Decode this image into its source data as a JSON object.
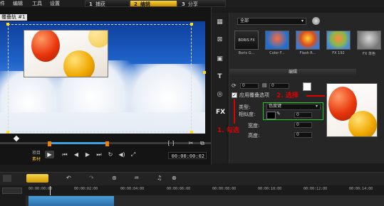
{
  "menu": [
    "件",
    "编辑",
    "工具",
    "设置"
  ],
  "steps": [
    {
      "num": "1",
      "label": "捕获"
    },
    {
      "num": "2",
      "label": "编辑"
    },
    {
      "num": "3",
      "label": "分享"
    }
  ],
  "preview": {
    "track_label": "覆叠轨 #1",
    "timecode": "00:00:00:02",
    "project_label": "项目",
    "clip_label": "素材"
  },
  "library": {
    "category": "全部",
    "thumbnails": [
      "Boris G...",
      "Color F...",
      "Flash R...",
      "FX 192",
      "FX 单色"
    ]
  },
  "options": {
    "tab_label": "编辑",
    "apply_overlay_label": "应用覆叠选项",
    "type_label": "类型:",
    "type_value": "色度键",
    "similarity_label": "相似度:",
    "width_label": "宽度:",
    "height_label": "高度:",
    "spin_value": "0"
  },
  "annotations": {
    "check": "1. 勾选",
    "choose": "2. 选择"
  },
  "timeline": {
    "ticks": [
      "00:00:00:00",
      "00:00:02:00",
      "00:00:04:00",
      "00:00:06:00",
      "00:00:08:00",
      "00:00:10:00",
      "00:00:12:00",
      "00:00:14:00"
    ]
  },
  "colors": {
    "accent": "#f4c020",
    "annotation": "#e00000",
    "highlight_box": "#22cc22"
  }
}
